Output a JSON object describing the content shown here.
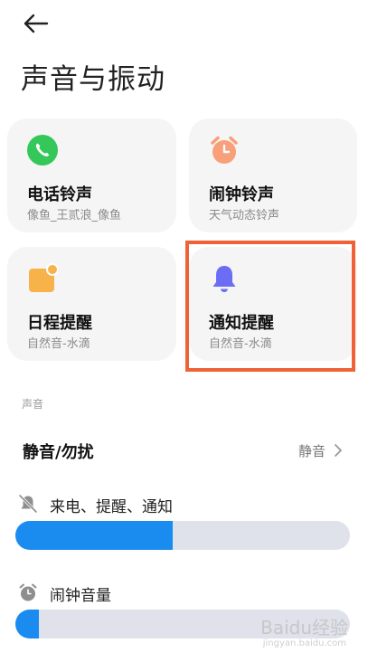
{
  "page": {
    "title": "声音与振动"
  },
  "cards": {
    "phone": {
      "title": "电话铃声",
      "subtitle": "像鱼_王贰浪_像鱼",
      "icon": "phone-icon",
      "color": "#34c759"
    },
    "alarm": {
      "title": "闹钟铃声",
      "subtitle": "天气动态铃声",
      "icon": "alarm-clock-icon",
      "color": "#f7a07a"
    },
    "calendar": {
      "title": "日程提醒",
      "subtitle": "自然音-水滴",
      "icon": "calendar-icon",
      "color": "#f7b24a"
    },
    "notify": {
      "title": "通知提醒",
      "subtitle": "自然音-水滴",
      "icon": "bell-icon",
      "color": "#6b6ef5"
    }
  },
  "sound": {
    "section_label": "声音",
    "mute": {
      "title": "静音/勿扰",
      "value": "静音"
    },
    "ring_volume": {
      "label": "来电、提醒、通知",
      "level": 0.47,
      "icon": "bell-muted-icon"
    },
    "alarm_volume": {
      "label": "闹钟音量",
      "level": 0.07,
      "icon": "alarm-clock-icon"
    }
  },
  "accent_color": "#1a8cf0",
  "highlight_color": "#ee6236",
  "watermark": {
    "text": "Baidu经验",
    "url": "jingyan.baidu.com"
  }
}
